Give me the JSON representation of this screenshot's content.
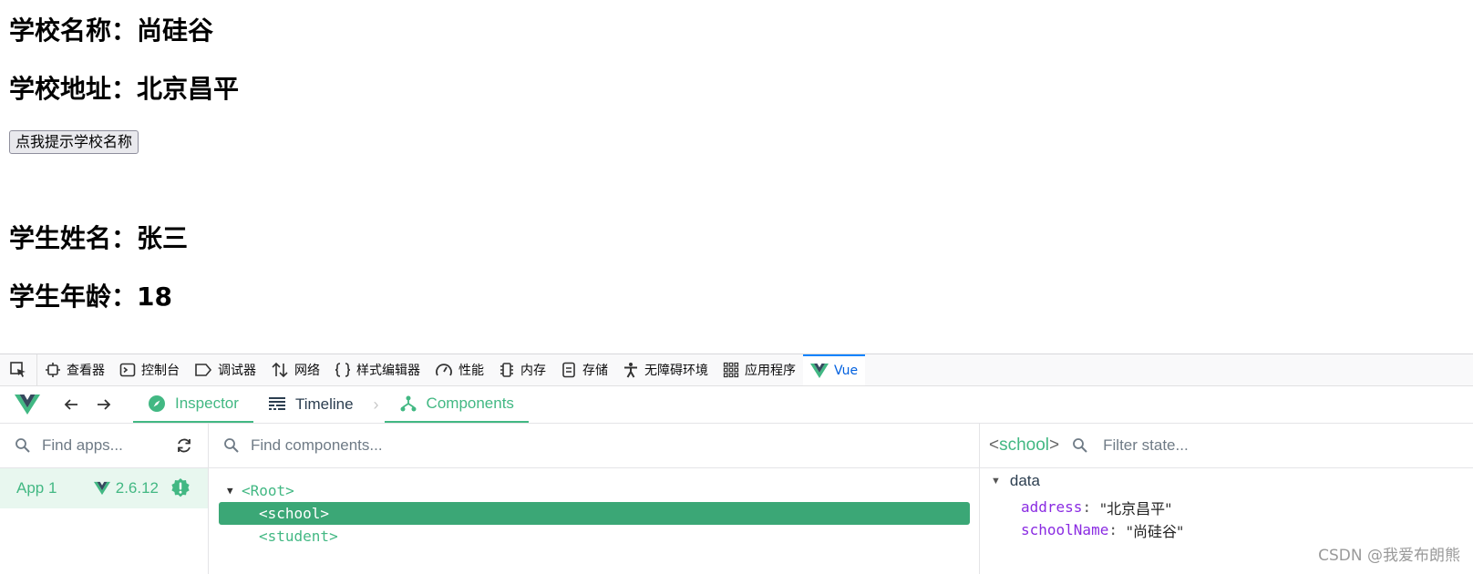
{
  "page": {
    "school_name_line": "学校名称：尚硅谷",
    "school_address_line": "学校地址：北京昌平",
    "alert_button": "点我提示学校名称",
    "student_name_line": "学生姓名：张三",
    "student_age_line": "学生年龄：18"
  },
  "devtools": {
    "tabs": [
      {
        "label": "查看器",
        "icon": "inspector-icon"
      },
      {
        "label": "控制台",
        "icon": "console-icon"
      },
      {
        "label": "调试器",
        "icon": "debugger-icon"
      },
      {
        "label": "网络",
        "icon": "network-icon"
      },
      {
        "label": "样式编辑器",
        "icon": "braces-icon"
      },
      {
        "label": "性能",
        "icon": "gauge-icon"
      },
      {
        "label": "内存",
        "icon": "memory-icon"
      },
      {
        "label": "存储",
        "icon": "storage-icon"
      },
      {
        "label": "无障碍环境",
        "icon": "accessibility-icon"
      },
      {
        "label": "应用程序",
        "icon": "grid-icon"
      },
      {
        "label": "Vue",
        "icon": "vue-logo-icon",
        "active": true
      }
    ],
    "accent": "#0a84ff"
  },
  "vue": {
    "tabs": {
      "inspector": "Inspector",
      "timeline": "Timeline",
      "components": "Components"
    },
    "apps": {
      "search_placeholder": "Find apps...",
      "items": [
        {
          "name": "App 1",
          "version": "2.6.12"
        }
      ]
    },
    "tree": {
      "search_placeholder": "Find components...",
      "nodes": {
        "root": "<Root>",
        "school": "<school>",
        "student": "<student>"
      }
    },
    "state": {
      "selected": "school",
      "search_placeholder": "Filter state...",
      "section": "data",
      "props": [
        {
          "key": "address",
          "value": "\"北京昌平\""
        },
        {
          "key": "schoolName",
          "value": "\"尚硅谷\""
        }
      ]
    },
    "accent": "#42b883"
  },
  "watermark": "CSDN @我爱布朗熊"
}
